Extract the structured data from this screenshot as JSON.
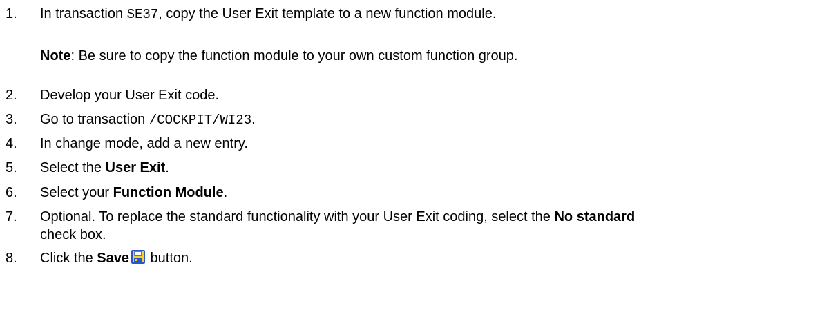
{
  "steps": [
    {
      "num": "1.",
      "text_pre": "In transaction ",
      "code": "SE37",
      "text_post": ", copy the User Exit template to a new function module."
    },
    {
      "num": "2.",
      "text": "Develop your User Exit code."
    },
    {
      "num": "3.",
      "text_pre": "Go to transaction ",
      "code": "/COCKPIT/WI23",
      "text_post": "."
    },
    {
      "num": "4.",
      "text": "In change mode, add a new entry."
    },
    {
      "num": "5.",
      "text_pre": "Select the ",
      "bold": "User Exit",
      "text_post": "."
    },
    {
      "num": "6.",
      "text_pre": "Select your ",
      "bold": "Function Module",
      "text_post": "."
    },
    {
      "num": "7.",
      "text_pre": "Optional. To replace the standard functionality with your User Exit coding, select the ",
      "bold": "No standard",
      "text_line2": "check box."
    },
    {
      "num": "8.",
      "text_pre": "Click the ",
      "bold": "Save",
      "icon": "save-icon",
      "text_post": " button."
    }
  ],
  "note": {
    "label": "Note",
    "text": ": Be sure to copy the function module to your own custom function group."
  },
  "colors": {
    "save_icon_border": "#2a56c6",
    "save_icon_fill": "#f2d233"
  }
}
